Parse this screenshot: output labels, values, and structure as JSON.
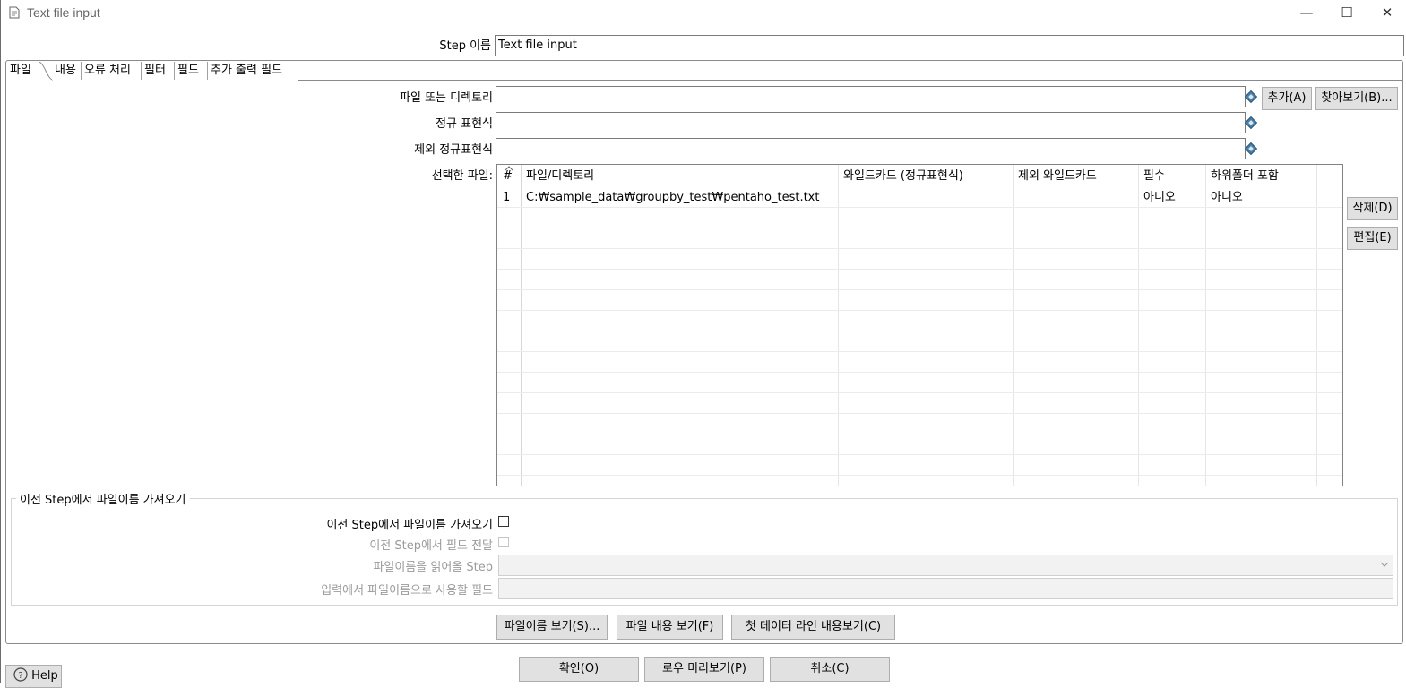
{
  "window": {
    "title": "Text file input",
    "minimize": "—",
    "maximize": "☐",
    "close": "✕"
  },
  "step": {
    "label": "Step 이름",
    "value": "Text file input"
  },
  "tabs": [
    "파일",
    "내용",
    "오류 처리",
    "필터",
    "필드",
    "추가 출력 필드"
  ],
  "file": {
    "file_or_dir_label": "파일 또는 디렉토리",
    "file_or_dir_value": "",
    "regex_label": "정규 표현식",
    "regex_value": "",
    "exclude_regex_label": "제외 정규표현식",
    "exclude_regex_value": "",
    "add_button": "추가(A)",
    "browse_button": "찾아보기(B)...",
    "selected_files_label": "선택한 파일:",
    "delete_button": "삭제(D)",
    "edit_button": "편집(E)"
  },
  "table": {
    "headers": [
      "#",
      "파일/디렉토리",
      "와일드카드 (정규표현식)",
      "제외 와일드카드",
      "필수",
      "하위폴더 포함"
    ],
    "rows": [
      [
        "1",
        "C:₩sample_data₩groupby_test₩pentaho_test.txt",
        "",
        "",
        "아니오",
        "아니오"
      ]
    ]
  },
  "prev_step": {
    "group_title": "이전 Step에서 파일이름 가져오기",
    "accept_label": "이전 Step에서 파일이름 가져오기",
    "pass_fields_label": "이전 Step에서 필드 전달",
    "step_label": "파일이름을 읽어올 Step",
    "field_label": "입력에서 파일이름으로 사용할 필드",
    "accept_checked": false,
    "pass_checked": false
  },
  "inner_buttons": {
    "show_filenames": "파일이름 보기(S)...",
    "show_content": "파일 내용 보기(F)",
    "show_first_line": "첫 데이터 라인 내용보기(C)"
  },
  "bottom_buttons": {
    "ok": "확인(O)",
    "preview": "로우 미리보기(P)",
    "cancel": "취소(C)",
    "help": "Help"
  },
  "icons": [
    "document-icon",
    "variable-icon",
    "help-icon",
    "chevron-down-icon",
    "sort-icon"
  ]
}
